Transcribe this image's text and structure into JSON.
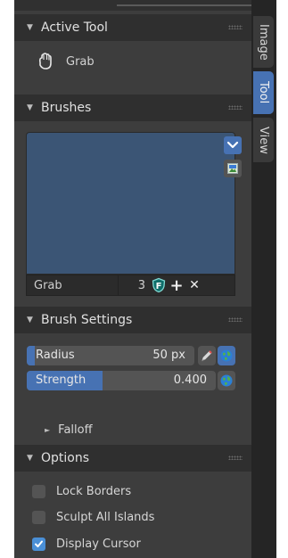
{
  "panels": {
    "active_tool": {
      "title": "Active Tool",
      "tool_name": "Grab"
    },
    "brushes": {
      "title": "Brushes",
      "brush_name": "Grab",
      "user_count": "3",
      "fake_user_glyph": "F",
      "add_glyph": "+",
      "remove_glyph": "✕"
    },
    "brush_settings": {
      "title": "Brush Settings",
      "radius_label": "Radius",
      "radius_value": "50 px",
      "strength_label": "Strength",
      "strength_value": "0.400",
      "falloff_label": "Falloff"
    },
    "options": {
      "title": "Options",
      "checkboxes": [
        {
          "label": "Lock Borders",
          "checked": false
        },
        {
          "label": "Sculpt All Islands",
          "checked": false
        },
        {
          "label": "Display Cursor",
          "checked": true
        }
      ]
    }
  },
  "tabs": [
    {
      "label": "Image",
      "active": false
    },
    {
      "label": "Tool",
      "active": true
    },
    {
      "label": "View",
      "active": false
    }
  ],
  "fills": {
    "radius_fraction": 0.05,
    "strength_fraction": 0.4
  },
  "colors": {
    "accent": "#4772b3",
    "panel_bg": "#3d3d3d",
    "header_bg": "#2f2f2f",
    "preview_bg": "#3b5575",
    "field_bg": "#545454"
  },
  "icons": {
    "collapse_arrow": "triangle-down-icon",
    "expand_arrow": "triangle-right-icon",
    "tool_icon": "grab-hand-icon",
    "dropdown": "chevron-down-icon",
    "image_browse": "image-browse-icon",
    "pressure": "pen-pressure-icon",
    "unified": "globe-icon"
  }
}
